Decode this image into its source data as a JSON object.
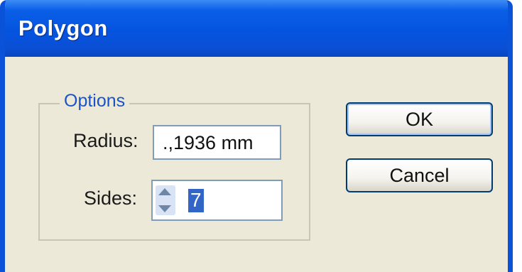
{
  "window": {
    "title": "Polygon"
  },
  "options_group": {
    "legend": "Options",
    "radius": {
      "label": "Radius:",
      "value": ".,1936 mm"
    },
    "sides": {
      "label": "Sides:",
      "value": "7"
    }
  },
  "buttons": {
    "ok": "OK",
    "cancel": "Cancel"
  },
  "colors": {
    "titlebar": "#0554e0",
    "dialog_bg": "#ece9d8",
    "legend_text": "#1a54c8",
    "selection": "#3166c6"
  }
}
